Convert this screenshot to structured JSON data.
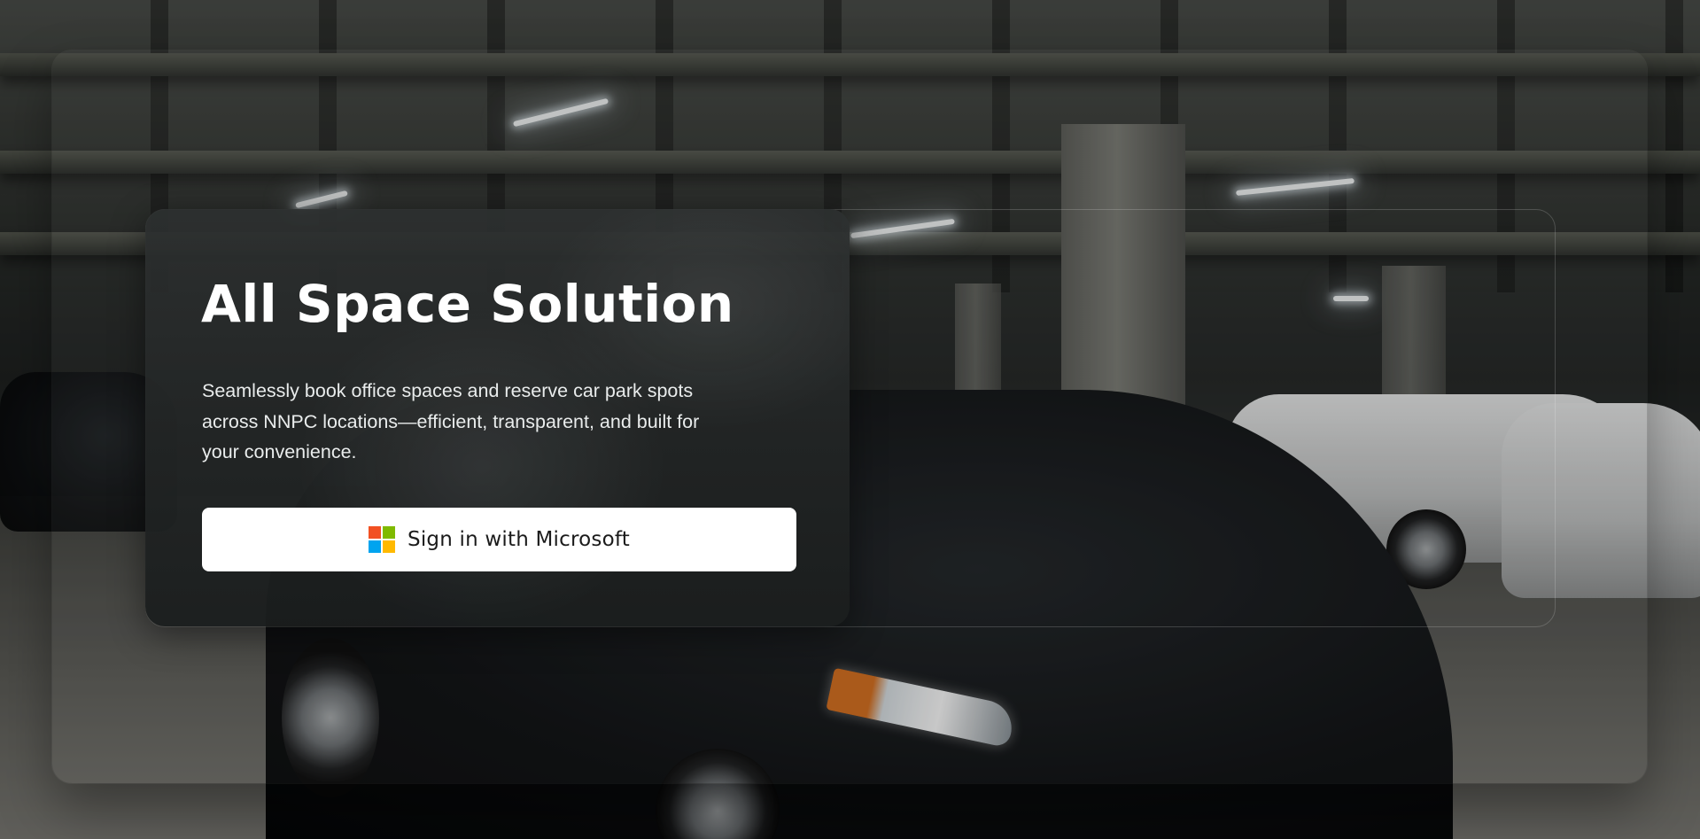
{
  "hero": {
    "title": "All Space Solution",
    "description": "Seamlessly book office spaces and reserve car park spots across NNPC locations—efficient, transparent, and built for your convenience."
  },
  "signin_button": {
    "label": "Sign in with Microsoft",
    "icon": "microsoft-logo-icon",
    "logo_colors": [
      "#f25022",
      "#7fba00",
      "#00a4ef",
      "#ffb900"
    ]
  },
  "background": {
    "scene": "underground car park"
  }
}
